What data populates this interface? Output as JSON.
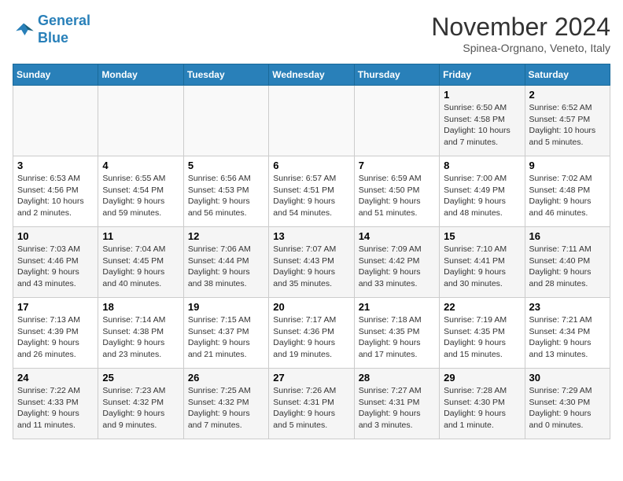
{
  "logo": {
    "line1": "General",
    "line2": "Blue"
  },
  "title": "November 2024",
  "subtitle": "Spinea-Orgnano, Veneto, Italy",
  "weekdays": [
    "Sunday",
    "Monday",
    "Tuesday",
    "Wednesday",
    "Thursday",
    "Friday",
    "Saturday"
  ],
  "weeks": [
    [
      {
        "day": "",
        "info": ""
      },
      {
        "day": "",
        "info": ""
      },
      {
        "day": "",
        "info": ""
      },
      {
        "day": "",
        "info": ""
      },
      {
        "day": "",
        "info": ""
      },
      {
        "day": "1",
        "info": "Sunrise: 6:50 AM\nSunset: 4:58 PM\nDaylight: 10 hours and 7 minutes."
      },
      {
        "day": "2",
        "info": "Sunrise: 6:52 AM\nSunset: 4:57 PM\nDaylight: 10 hours and 5 minutes."
      }
    ],
    [
      {
        "day": "3",
        "info": "Sunrise: 6:53 AM\nSunset: 4:56 PM\nDaylight: 10 hours and 2 minutes."
      },
      {
        "day": "4",
        "info": "Sunrise: 6:55 AM\nSunset: 4:54 PM\nDaylight: 9 hours and 59 minutes."
      },
      {
        "day": "5",
        "info": "Sunrise: 6:56 AM\nSunset: 4:53 PM\nDaylight: 9 hours and 56 minutes."
      },
      {
        "day": "6",
        "info": "Sunrise: 6:57 AM\nSunset: 4:51 PM\nDaylight: 9 hours and 54 minutes."
      },
      {
        "day": "7",
        "info": "Sunrise: 6:59 AM\nSunset: 4:50 PM\nDaylight: 9 hours and 51 minutes."
      },
      {
        "day": "8",
        "info": "Sunrise: 7:00 AM\nSunset: 4:49 PM\nDaylight: 9 hours and 48 minutes."
      },
      {
        "day": "9",
        "info": "Sunrise: 7:02 AM\nSunset: 4:48 PM\nDaylight: 9 hours and 46 minutes."
      }
    ],
    [
      {
        "day": "10",
        "info": "Sunrise: 7:03 AM\nSunset: 4:46 PM\nDaylight: 9 hours and 43 minutes."
      },
      {
        "day": "11",
        "info": "Sunrise: 7:04 AM\nSunset: 4:45 PM\nDaylight: 9 hours and 40 minutes."
      },
      {
        "day": "12",
        "info": "Sunrise: 7:06 AM\nSunset: 4:44 PM\nDaylight: 9 hours and 38 minutes."
      },
      {
        "day": "13",
        "info": "Sunrise: 7:07 AM\nSunset: 4:43 PM\nDaylight: 9 hours and 35 minutes."
      },
      {
        "day": "14",
        "info": "Sunrise: 7:09 AM\nSunset: 4:42 PM\nDaylight: 9 hours and 33 minutes."
      },
      {
        "day": "15",
        "info": "Sunrise: 7:10 AM\nSunset: 4:41 PM\nDaylight: 9 hours and 30 minutes."
      },
      {
        "day": "16",
        "info": "Sunrise: 7:11 AM\nSunset: 4:40 PM\nDaylight: 9 hours and 28 minutes."
      }
    ],
    [
      {
        "day": "17",
        "info": "Sunrise: 7:13 AM\nSunset: 4:39 PM\nDaylight: 9 hours and 26 minutes."
      },
      {
        "day": "18",
        "info": "Sunrise: 7:14 AM\nSunset: 4:38 PM\nDaylight: 9 hours and 23 minutes."
      },
      {
        "day": "19",
        "info": "Sunrise: 7:15 AM\nSunset: 4:37 PM\nDaylight: 9 hours and 21 minutes."
      },
      {
        "day": "20",
        "info": "Sunrise: 7:17 AM\nSunset: 4:36 PM\nDaylight: 9 hours and 19 minutes."
      },
      {
        "day": "21",
        "info": "Sunrise: 7:18 AM\nSunset: 4:35 PM\nDaylight: 9 hours and 17 minutes."
      },
      {
        "day": "22",
        "info": "Sunrise: 7:19 AM\nSunset: 4:35 PM\nDaylight: 9 hours and 15 minutes."
      },
      {
        "day": "23",
        "info": "Sunrise: 7:21 AM\nSunset: 4:34 PM\nDaylight: 9 hours and 13 minutes."
      }
    ],
    [
      {
        "day": "24",
        "info": "Sunrise: 7:22 AM\nSunset: 4:33 PM\nDaylight: 9 hours and 11 minutes."
      },
      {
        "day": "25",
        "info": "Sunrise: 7:23 AM\nSunset: 4:32 PM\nDaylight: 9 hours and 9 minutes."
      },
      {
        "day": "26",
        "info": "Sunrise: 7:25 AM\nSunset: 4:32 PM\nDaylight: 9 hours and 7 minutes."
      },
      {
        "day": "27",
        "info": "Sunrise: 7:26 AM\nSunset: 4:31 PM\nDaylight: 9 hours and 5 minutes."
      },
      {
        "day": "28",
        "info": "Sunrise: 7:27 AM\nSunset: 4:31 PM\nDaylight: 9 hours and 3 minutes."
      },
      {
        "day": "29",
        "info": "Sunrise: 7:28 AM\nSunset: 4:30 PM\nDaylight: 9 hours and 1 minute."
      },
      {
        "day": "30",
        "info": "Sunrise: 7:29 AM\nSunset: 4:30 PM\nDaylight: 9 hours and 0 minutes."
      }
    ]
  ]
}
